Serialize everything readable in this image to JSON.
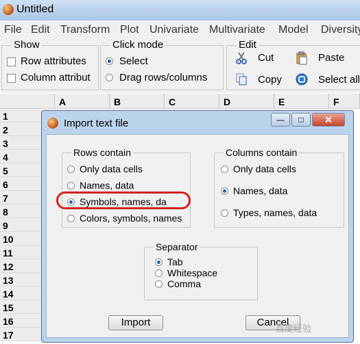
{
  "window": {
    "title": "Untitled"
  },
  "menubar": [
    "File",
    "Edit",
    "Transform",
    "Plot",
    "Univariate",
    "Multivariate",
    "Model",
    "Diversity"
  ],
  "toolbar": {
    "show": {
      "title": "Show",
      "row_attributes": "Row attributes",
      "column_attributes": "Column attribut"
    },
    "click_mode": {
      "title": "Click mode",
      "select": "Select",
      "drag": "Drag rows/columns"
    },
    "edit": {
      "title": "Edit",
      "cut": "Cut",
      "copy": "Copy",
      "paste": "Paste",
      "select_all": "Select all"
    }
  },
  "grid": {
    "columns": [
      "A",
      "B",
      "C",
      "D",
      "E",
      "F"
    ],
    "rows": [
      "1",
      "2",
      "3",
      "4",
      "5",
      "6",
      "7",
      "8",
      "9",
      "10",
      "11",
      "12",
      "13",
      "14",
      "15",
      "16",
      "17"
    ]
  },
  "dialog": {
    "title": "Import text file",
    "rows_contain": {
      "title": "Rows contain",
      "options": [
        "Only data cells",
        "Names, data",
        "Symbols, names, da",
        "Colors, symbols, names"
      ],
      "selected": 2
    },
    "columns_contain": {
      "title": "Columns contain",
      "options": [
        "Only data cells",
        "Names, data",
        "Types, names, data"
      ],
      "selected": 1
    },
    "separator": {
      "title": "Separator",
      "options": [
        "Tab",
        "Whitespace",
        "Comma"
      ],
      "selected": 0
    },
    "import_label": "Import",
    "cancel_label": "Cancel"
  },
  "watermark": "百度经验"
}
